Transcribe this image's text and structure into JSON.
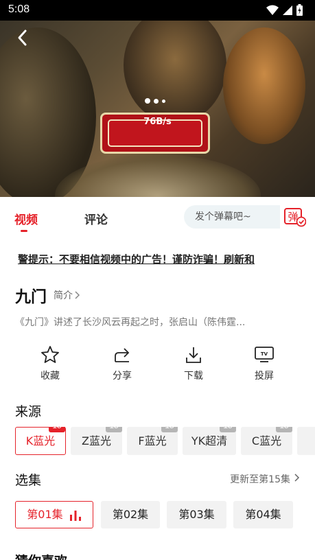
{
  "status_bar": {
    "time": "5:08"
  },
  "player": {
    "download_speed": "76B/s"
  },
  "tabs": {
    "video": "视频",
    "comments": "评论"
  },
  "danmaku": {
    "placeholder": "发个弹幕吧~",
    "button_label": "弹"
  },
  "notice": "警提示：不要相信视频中的广告！谨防诈骗！刷新和",
  "show": {
    "title": "九门",
    "intro_label": "简介",
    "synopsis": "《九门》讲述了长沙风云再起之时，张启山（陈伟霆..."
  },
  "actions": [
    {
      "label": "收藏",
      "icon": "star-icon"
    },
    {
      "label": "分享",
      "icon": "share-icon"
    },
    {
      "label": "下载",
      "icon": "download-icon"
    },
    {
      "label": "投屏",
      "icon": "cast-tv-icon"
    }
  ],
  "sources": {
    "title": "来源",
    "items": [
      {
        "label": "K蓝光",
        "count": "15",
        "active": true
      },
      {
        "label": "Z蓝光",
        "count": "15"
      },
      {
        "label": "F蓝光",
        "count": "15"
      },
      {
        "label": "YK超清",
        "count": "15"
      },
      {
        "label": "C蓝光",
        "count": "15"
      }
    ]
  },
  "episodes": {
    "title": "选集",
    "update_text": "更新至第15集",
    "items": [
      {
        "label": "第01集",
        "active": true
      },
      {
        "label": "第02集"
      },
      {
        "label": "第03集"
      },
      {
        "label": "第04集"
      }
    ]
  },
  "recommend": {
    "title": "猜你喜欢"
  },
  "colors": {
    "accent": "#e5222a",
    "chip_bg": "#f2f2f2",
    "badge_gray": "#b5b5b5"
  }
}
